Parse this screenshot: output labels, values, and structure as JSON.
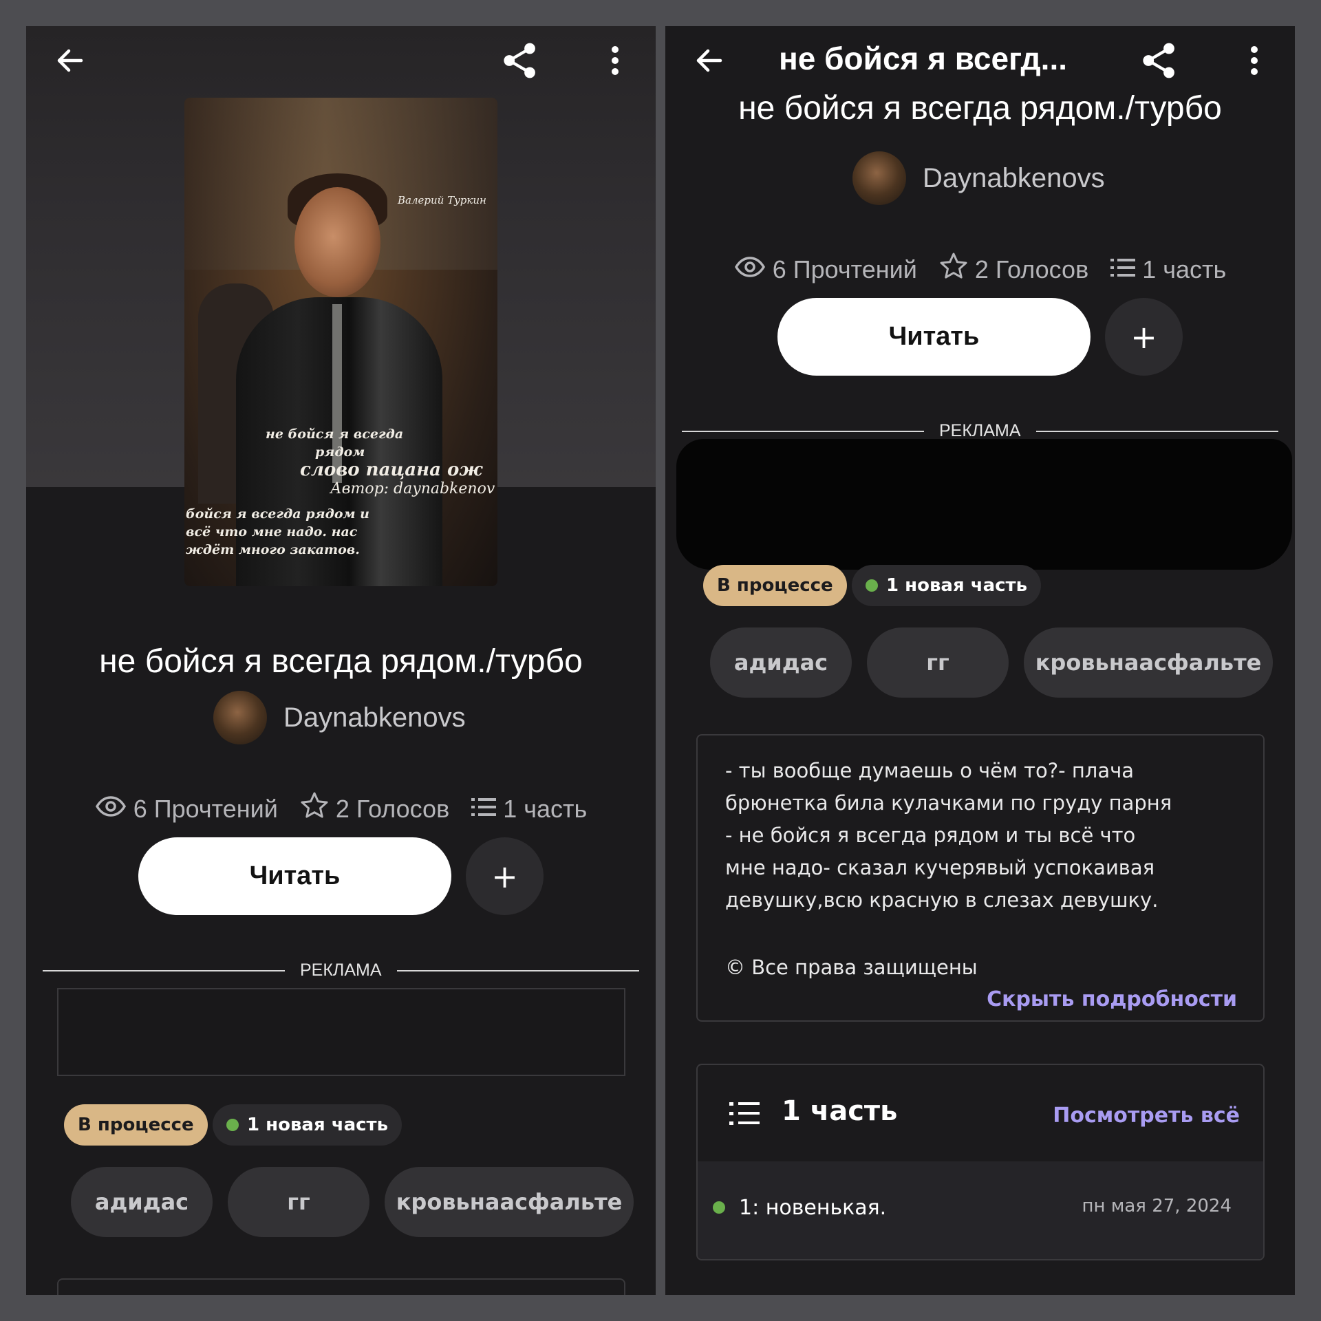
{
  "left": {
    "cover_texts": {
      "signature": "Валерий Туркин",
      "line1": "не бойся я всегда",
      "line2": "рядом",
      "line3": "слово пацана ож",
      "line4": "Автор: daynabkenov",
      "line5": "бойся я всегда рядом и",
      "line6": "всё что мне надо. нас",
      "line7": "ждёт много закатов."
    },
    "title": "не бойся я всегда рядом./турбо",
    "author": "Daynabkenovs",
    "stats": {
      "reads": "6 Прочтений",
      "votes": "2 Голосов",
      "parts": "1 часть"
    },
    "read_button": "Читать",
    "plus_button": "+",
    "ad_label": "РЕКЛАМА",
    "status": "В процессе",
    "new_part": "1 новая часть",
    "tags": [
      "адидас",
      "гг",
      "кровьнаасфальте"
    ]
  },
  "right": {
    "bar_title": "не бойся я всегд...",
    "title": "не бойся я всегда рядом./турбо",
    "author": "Daynabkenovs",
    "stats": {
      "reads": "6 Прочтений",
      "votes": "2 Голосов",
      "parts": "1 часть"
    },
    "read_button": "Читать",
    "plus_button": "+",
    "ad_label": "РЕКЛАМА",
    "status": "В процессе",
    "new_part": "1 новая часть",
    "tags": [
      "адидас",
      "гг",
      "кровьнаасфальте"
    ],
    "description": "- ты вообще думаешь о чём то?- плача\nбрюнетка била кулачками по груду парня\n- не бойся я всегда рядом и ты всё что\nмне надо- сказал кучерявый успокаивая\nдевушку,всю красную в слезах девушку.",
    "rights": "© Все права защищены",
    "hide_details": "Скрыть подробности",
    "parts_header": "1 часть",
    "see_all": "Посмотреть всё",
    "part": {
      "title": "1: новенькая.",
      "date": "пн мая 27, 2024"
    }
  },
  "icons": [
    "back-arrow-icon",
    "share-icon",
    "more-vert-icon",
    "eye-icon",
    "star-icon",
    "list-icon"
  ],
  "colors": {
    "background": "#1b1a1c",
    "accent_link": "#a99cf2",
    "status_pill": "#d9b786",
    "new_dot": "#6ab04c"
  }
}
